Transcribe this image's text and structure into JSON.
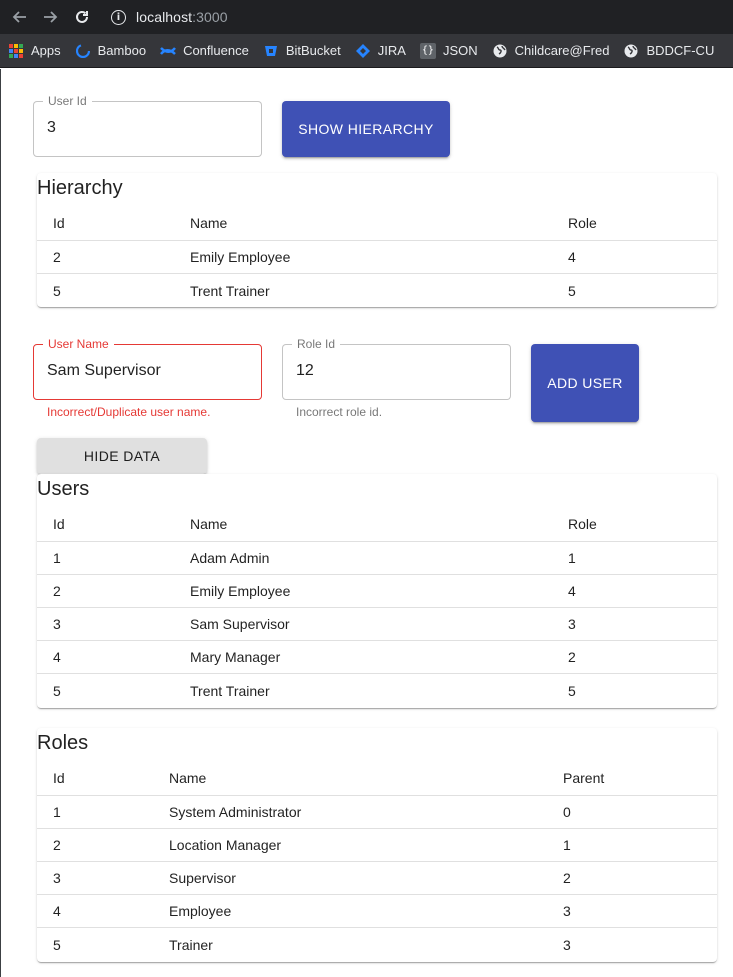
{
  "browser": {
    "url_host": "localhost",
    "url_port": ":3000",
    "bookmarks": [
      {
        "label": "Apps",
        "icon": "apps-grid-icon"
      },
      {
        "label": "Bamboo",
        "icon": "bamboo-icon"
      },
      {
        "label": "Confluence",
        "icon": "confluence-icon"
      },
      {
        "label": "BitBucket",
        "icon": "bitbucket-icon"
      },
      {
        "label": "JIRA",
        "icon": "jira-icon"
      },
      {
        "label": "JSON",
        "icon": "json-icon"
      },
      {
        "label": "Childcare@Fred",
        "icon": "globe-icon"
      },
      {
        "label": "BDDCF-CU",
        "icon": "globe-icon"
      }
    ]
  },
  "hierarchy_form": {
    "user_id_label": "User Id",
    "user_id_value": "3",
    "show_button": "Show Hierarchy"
  },
  "hierarchy": {
    "title": "Hierarchy",
    "headers": [
      "Id",
      "Name",
      "Role"
    ],
    "rows": [
      [
        "2",
        "Emily Employee",
        "4"
      ],
      [
        "5",
        "Trent Trainer",
        "5"
      ]
    ]
  },
  "add_user_form": {
    "user_name_label": "User Name",
    "user_name_value": "Sam Supervisor",
    "user_name_error": "Incorrect/Duplicate user name.",
    "role_id_label": "Role Id",
    "role_id_value": "12",
    "role_id_helper": "Incorrect role id.",
    "add_button": "Add User"
  },
  "hide_button": "Hide Data",
  "users": {
    "title": "Users",
    "headers": [
      "Id",
      "Name",
      "Role"
    ],
    "rows": [
      [
        "1",
        "Adam Admin",
        "1"
      ],
      [
        "2",
        "Emily Employee",
        "4"
      ],
      [
        "3",
        "Sam Supervisor",
        "3"
      ],
      [
        "4",
        "Mary Manager",
        "2"
      ],
      [
        "5",
        "Trent Trainer",
        "5"
      ]
    ]
  },
  "roles": {
    "title": "Roles",
    "headers": [
      "Id",
      "Name",
      "Parent"
    ],
    "rows": [
      [
        "1",
        "System Administrator",
        "0"
      ],
      [
        "2",
        "Location Manager",
        "1"
      ],
      [
        "3",
        "Supervisor",
        "2"
      ],
      [
        "4",
        "Employee",
        "3"
      ],
      [
        "5",
        "Trainer",
        "3"
      ]
    ]
  },
  "colors": {
    "primary": "#3f51b5",
    "error": "#e53935",
    "chrome_dark": "#202124",
    "bookmark_bar": "#35363a"
  }
}
